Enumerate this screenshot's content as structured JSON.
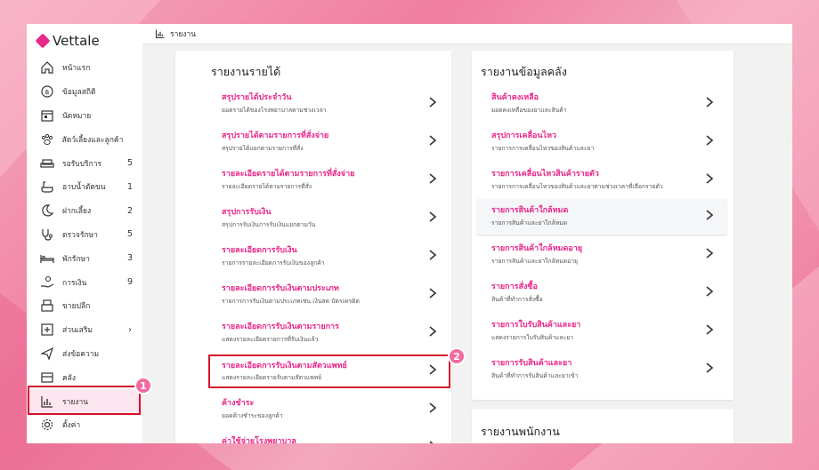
{
  "app": {
    "name": "Vettale"
  },
  "topbar": {
    "title": "รายงาน"
  },
  "sidebar": {
    "items": [
      {
        "label": "หน้าแรก",
        "count": "",
        "icon": "home-icon"
      },
      {
        "label": "ข้อมูลสถิติ",
        "count": "",
        "icon": "stats-icon"
      },
      {
        "label": "นัดหมาย",
        "count": "",
        "icon": "calendar-icon"
      },
      {
        "label": "สัตว์เลี้ยงและลูกค้า",
        "count": "",
        "icon": "paw-icon"
      },
      {
        "label": "รอรับบริการ",
        "count": "5",
        "icon": "sofa-icon"
      },
      {
        "label": "อาบน้ำตัดขน",
        "count": "1",
        "icon": "bath-icon"
      },
      {
        "label": "ฝากเลี้ยง",
        "count": "2",
        "icon": "moon-icon"
      },
      {
        "label": "ตรวจรักษา",
        "count": "5",
        "icon": "stethoscope-icon"
      },
      {
        "label": "พักรักษา",
        "count": "3",
        "icon": "bed-icon"
      },
      {
        "label": "การเงิน",
        "count": "9",
        "icon": "money-hand-icon"
      },
      {
        "label": "ขายปลีก",
        "count": "",
        "icon": "register-icon"
      },
      {
        "label": "ส่วนเสริม",
        "count": "›",
        "icon": "plus-box-icon"
      },
      {
        "label": "ส่งข้อความ",
        "count": "",
        "icon": "send-icon"
      },
      {
        "label": "คลัง",
        "count": "",
        "icon": "box-icon"
      },
      {
        "label": "รายงาน",
        "count": "",
        "icon": "chart-icon"
      },
      {
        "label": "ตั้งค่า",
        "count": "",
        "icon": "gear-icon"
      }
    ]
  },
  "income_card": {
    "title": "รายงานรายได้",
    "rows": [
      {
        "title": "สรุปรายได้ประจำวัน",
        "subtitle": "ยอดรายได้ของโรงพยาบาลตามช่วงเวลา"
      },
      {
        "title": "สรุปรายได้ตามรายการที่สั่งจ่าย",
        "subtitle": "สรุปรายได้แยกตามรายการที่สั่ง"
      },
      {
        "title": "รายละเอียดรายได้ตามรายการที่สั่งจ่าย",
        "subtitle": "รายละเอียดรายได้ตามรายการที่สั่ง"
      },
      {
        "title": "สรุปการรับเงิน",
        "subtitle": "สรุปการรับเงินการรับเงินแยกตามวัน"
      },
      {
        "title": "รายละเอียดการรับเงิน",
        "subtitle": "รายการรายละเอียดการรับเงินของลูกค้า"
      },
      {
        "title": "รายละเอียดการรับเงินตามประเภท",
        "subtitle": "รายการการรับเงินตามประเภทเช่น เงินสด บัตรเครดิต"
      },
      {
        "title": "รายละเอียดการรับเงินตามรายการ",
        "subtitle": "แสดงรายละเอียดรายการที่รับเงินแล้ว"
      },
      {
        "title": "รายละเอียดการรับเงินตามสัตวแพทย์",
        "subtitle": "แสดงรายละเอียดรายรับตามสัตวแพทย์"
      },
      {
        "title": "ค้างชำระ",
        "subtitle": "ยอดค้างชำระของลูกค้า"
      },
      {
        "title": "ค่าใช้จ่ายโรงพยาบาล",
        "subtitle": ""
      }
    ]
  },
  "inventory_card": {
    "title": "รายงานข้อมูลคลัง",
    "rows": [
      {
        "title": "สินค้าคงเหลือ",
        "subtitle": "ยอดคงเหลือของยาและสินค้า"
      },
      {
        "title": "สรุปการเคลื่อนไหว",
        "subtitle": "รายการการเคลื่อนไหวของสินค้าและยา"
      },
      {
        "title": "รายการเคลื่อนไหวสินค้ารายตัว",
        "subtitle": "รายการการเคลื่อนไหวของสินค้าและยาตามช่วงเวลาที่เลือกรายตัว"
      },
      {
        "title": "รายการสินค้าใกล้หมด",
        "subtitle": "รายการสินค้าและยาใกล้หมด"
      },
      {
        "title": "รายการสินค้าใกล้หมดอายุ",
        "subtitle": "รายการสินค้าและยาใกล้หมดอายุ"
      },
      {
        "title": "รายการสั่งซื้อ",
        "subtitle": "สินค้าที่ทำการสั่งซื้อ"
      },
      {
        "title": "รายการใบรับสินค้าและยา",
        "subtitle": "แสดงรายการใบรับสินค้าและยา"
      },
      {
        "title": "รายการรับสินค้าและยา",
        "subtitle": "สินค้าที่ทำการรับสินค้าและยาเข้า"
      }
    ]
  },
  "staff_card": {
    "title": "รายงานพนักงาน"
  },
  "callouts": {
    "one": "1",
    "two": "2"
  },
  "colors": {
    "accent": "#e8288a",
    "highlight": "#d7122b",
    "badge": "#f36aa0"
  }
}
